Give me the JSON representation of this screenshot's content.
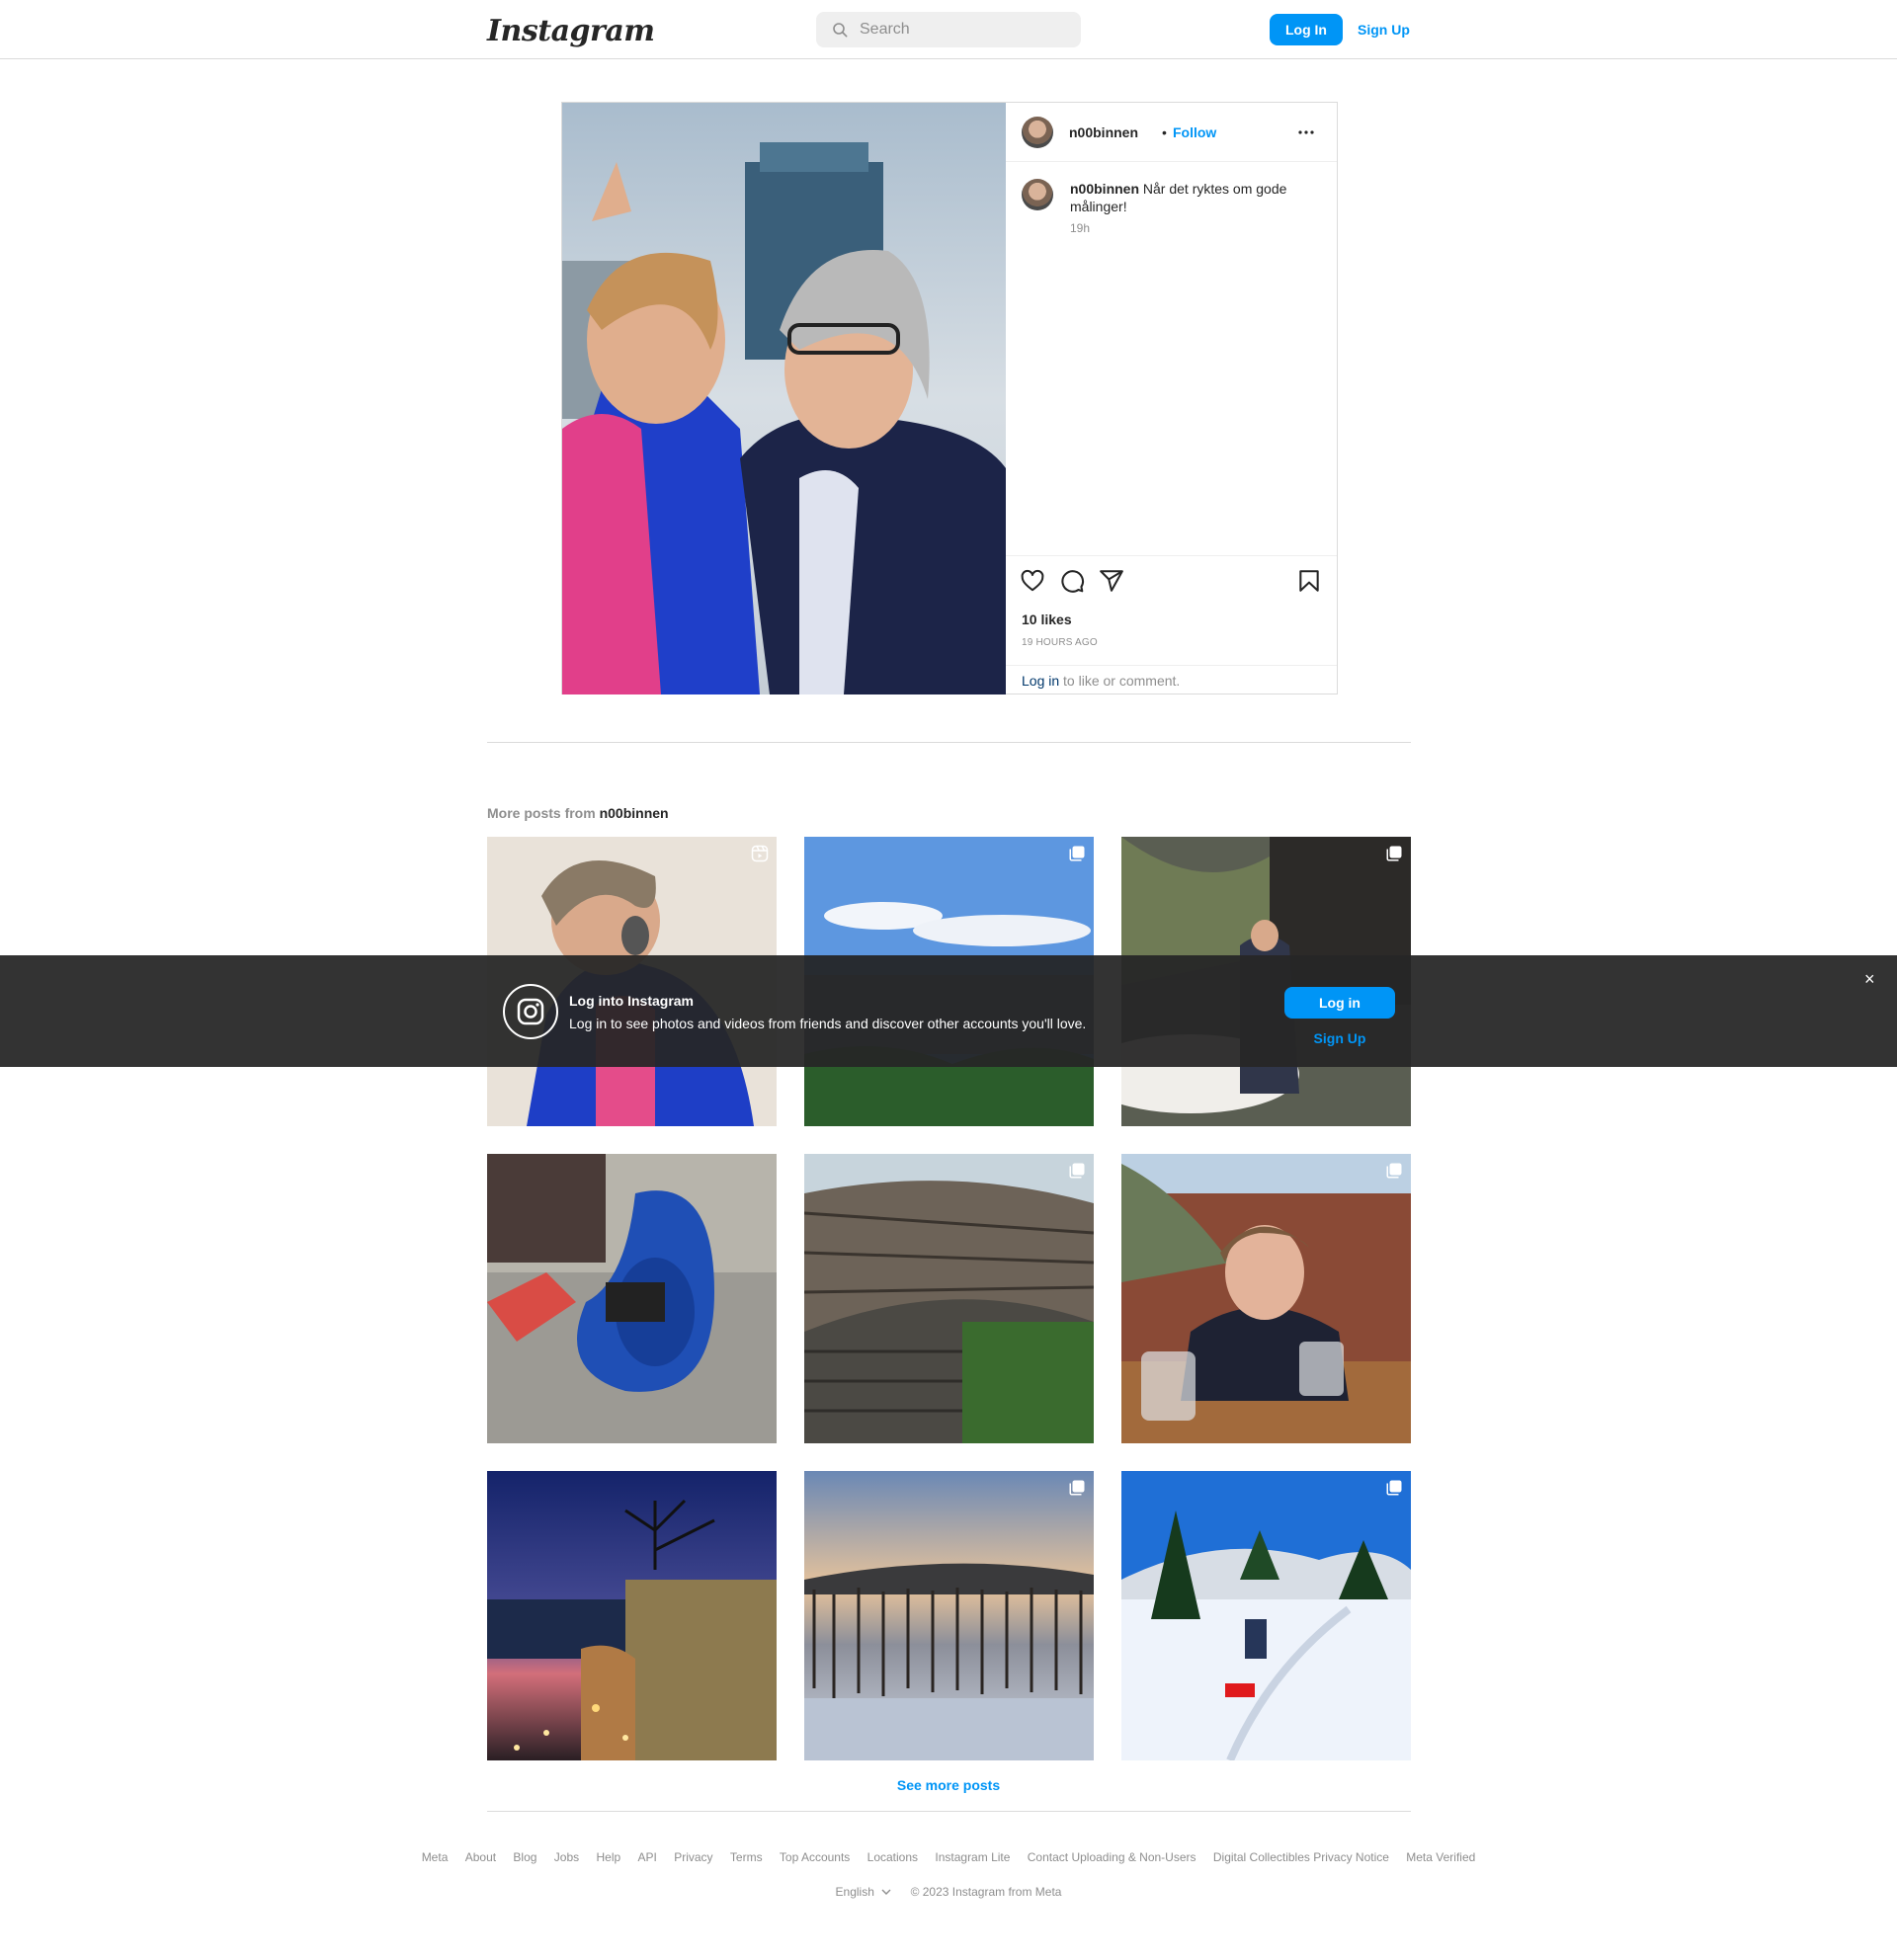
{
  "nav": {
    "logo": "Instagram",
    "search_placeholder": "Search",
    "login_label": "Log In",
    "signup_label": "Sign Up"
  },
  "post": {
    "username": "n00binnen",
    "separator": "•",
    "follow_label": "Follow",
    "caption_user": "n00binnen",
    "caption_text": "Når det ryktes om gode målinger!",
    "caption_time": "19h",
    "likes": "10 likes",
    "time_ago": "19 HOURS AGO",
    "login_link": "Log in",
    "login_suffix": " to like or comment."
  },
  "more_posts": {
    "prefix": "More posts from ",
    "username": "n00binnen",
    "see_more": "See more posts"
  },
  "footer": {
    "links": [
      "Meta",
      "About",
      "Blog",
      "Jobs",
      "Help",
      "API",
      "Privacy",
      "Terms",
      "Top Accounts",
      "Locations",
      "Instagram Lite",
      "Contact Uploading & Non-Users",
      "Digital Collectibles Privacy Notice",
      "Meta Verified"
    ],
    "language": "English",
    "copyright": "© 2023 Instagram from Meta"
  },
  "banner": {
    "title": "Log into Instagram",
    "text": "Log in to see photos and videos from friends and discover other accounts you'll love.",
    "login_label": "Log in",
    "signup_label": "Sign Up",
    "close_glyph": "×"
  },
  "colors": {
    "accent": "#0095f6",
    "text": "#262626",
    "muted": "#8e8e8e",
    "border": "#dbdbdb",
    "link_dark": "#00376b"
  }
}
